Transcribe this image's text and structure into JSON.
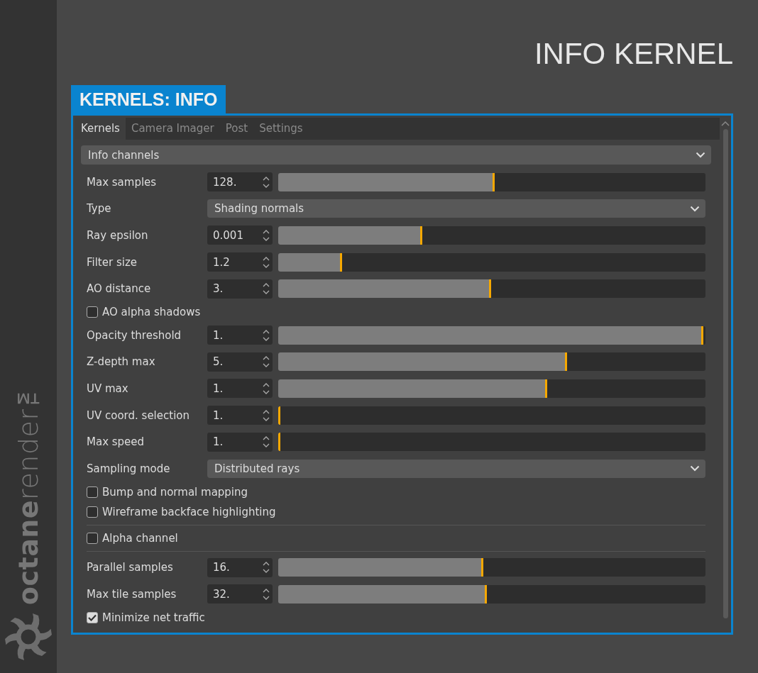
{
  "page_title": "INFO KERNEL",
  "logo": {
    "text": "**octane**render™"
  },
  "panel": {
    "label": "KERNELS: INFO",
    "tabs": [
      {
        "label": "Kernels",
        "selected": true
      },
      {
        "label": "Camera Imager",
        "selected": false
      },
      {
        "label": "Post",
        "selected": false
      },
      {
        "label": "Settings",
        "selected": false
      }
    ],
    "kernel_type": {
      "value": "Info channels"
    },
    "rows": [
      {
        "kind": "slider",
        "label": "Max samples",
        "value": "128.",
        "level": 0.506
      },
      {
        "kind": "dropdown",
        "label": "Type",
        "value": "Shading normals"
      },
      {
        "kind": "slider",
        "label": "Ray epsilon",
        "value": "0.001",
        "level": 0.337
      },
      {
        "kind": "slider",
        "label": "Filter size",
        "value": "1.2",
        "level": 0.149
      },
      {
        "kind": "slider",
        "label": "AO distance",
        "value": "3.",
        "level": 0.498
      },
      {
        "kind": "checkbox",
        "label": "AO alpha shadows",
        "checked": false
      },
      {
        "kind": "slider",
        "label": "Opacity threshold",
        "value": "1.",
        "level": 0.995
      },
      {
        "kind": "slider",
        "label": "Z-depth max",
        "value": "5.",
        "level": 0.676
      },
      {
        "kind": "slider",
        "label": "UV max",
        "value": "1.",
        "level": 0.63
      },
      {
        "kind": "slider",
        "label": "UV coord. selection",
        "value": "1.",
        "level": 0
      },
      {
        "kind": "slider",
        "label": "Max speed",
        "value": "1.",
        "level": 0
      },
      {
        "kind": "dropdown",
        "label": "Sampling mode",
        "value": "Distributed rays"
      },
      {
        "kind": "checkbox",
        "label": "Bump and normal mapping",
        "checked": false
      },
      {
        "kind": "checkbox",
        "label": "Wireframe backface highlighting",
        "checked": false
      },
      {
        "kind": "separator"
      },
      {
        "kind": "checkbox",
        "label": "Alpha channel",
        "checked": false
      },
      {
        "kind": "separator"
      },
      {
        "kind": "slider",
        "label": "Parallel samples",
        "value": "16.",
        "level": 0.48
      },
      {
        "kind": "slider",
        "label": "Max tile samples",
        "value": "32.",
        "level": 0.488
      },
      {
        "kind": "checkbox",
        "label": "Minimize net traffic",
        "checked": true
      }
    ]
  }
}
